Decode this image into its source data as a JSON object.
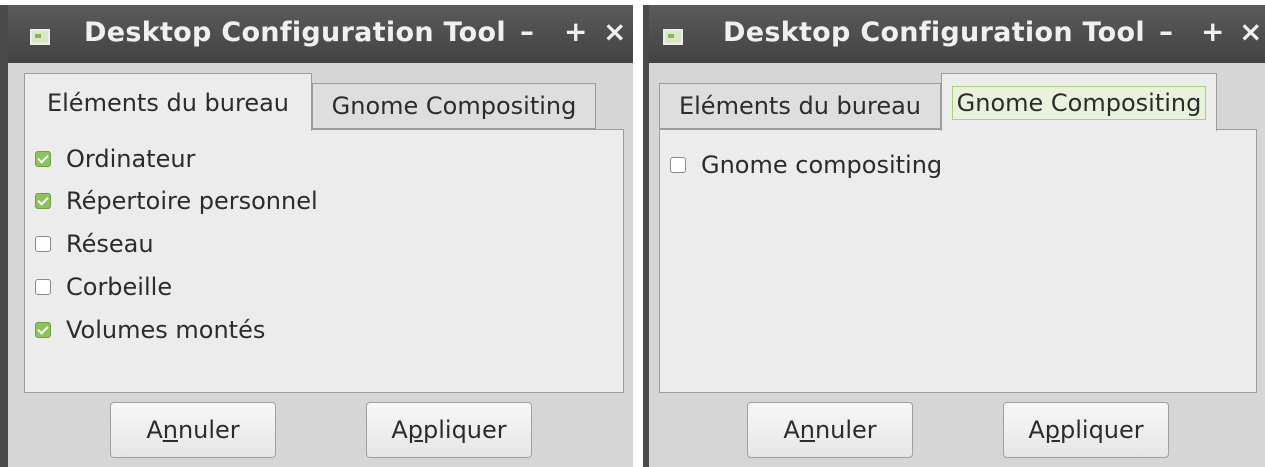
{
  "windows": [
    {
      "title": "Desktop Configuration Tool",
      "controls": {
        "minimize": "–",
        "maximize": "+",
        "close": "×"
      },
      "tabs": [
        {
          "label": "Eléments du bureau",
          "active": true
        },
        {
          "label": "Gnome Compositing",
          "active": false
        }
      ],
      "options": [
        {
          "label": "Ordinateur",
          "checked": true
        },
        {
          "label": "Répertoire personnel",
          "checked": true
        },
        {
          "label": "Réseau",
          "checked": false
        },
        {
          "label": "Corbeille",
          "checked": false
        },
        {
          "label": "Volumes montés",
          "checked": true
        }
      ],
      "buttons": {
        "cancel": {
          "pre": "A",
          "mnemonic": "n",
          "post": "nuler"
        },
        "apply": {
          "pre": "A",
          "mnemonic": "p",
          "post": "pliquer"
        }
      }
    },
    {
      "title": "Desktop Configuration Tool",
      "controls": {
        "minimize": "–",
        "maximize": "+",
        "close": "×"
      },
      "tabs": [
        {
          "label": "Eléments du bureau",
          "active": false
        },
        {
          "label": "Gnome Compositing",
          "active": true
        }
      ],
      "options": [
        {
          "label": "Gnome compositing",
          "checked": false
        }
      ],
      "buttons": {
        "cancel": {
          "pre": "A",
          "mnemonic": "n",
          "post": "nuler"
        },
        "apply": {
          "pre": "A",
          "mnemonic": "p",
          "post": "pliquer"
        }
      }
    }
  ]
}
